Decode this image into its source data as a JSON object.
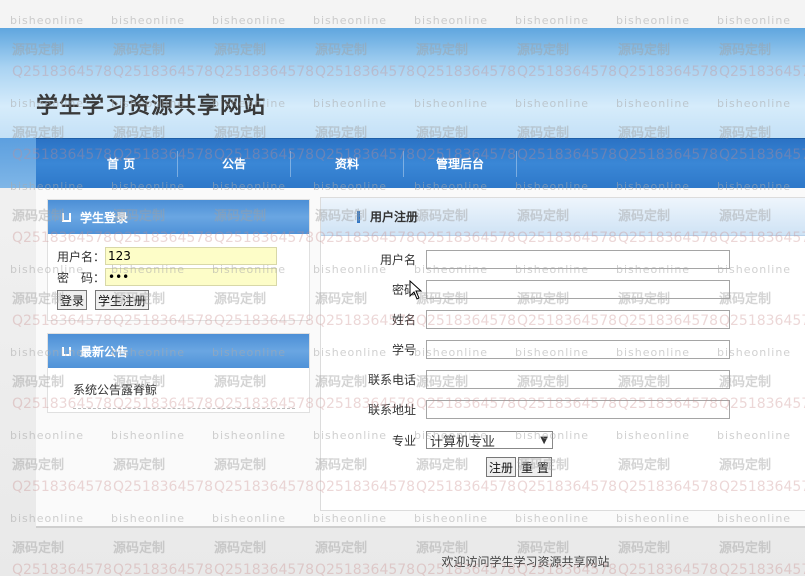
{
  "site": {
    "title": "学生学习资源共享网站"
  },
  "nav": {
    "items": [
      "首 页",
      "公告",
      "资料",
      "管理后台"
    ]
  },
  "login": {
    "title": "学生登录",
    "username_label": "用户名：",
    "username_value": "123",
    "password_label": "密　码：",
    "password_value": "123",
    "login_button": "登录",
    "register_button": "学生注册"
  },
  "notice": {
    "title": "最新公告",
    "items": [
      "系统公告露脊鲸"
    ]
  },
  "register_form": {
    "title": "用户注册",
    "fields": [
      {
        "label": "用户名",
        "value": ""
      },
      {
        "label": "密码",
        "value": ""
      },
      {
        "label": "姓名",
        "value": ""
      },
      {
        "label": "学号",
        "value": ""
      },
      {
        "label": "联系电话",
        "value": ""
      },
      {
        "label": "联系地址",
        "value": ""
      }
    ],
    "major_label": "专业",
    "major_selected": "计算机专业",
    "submit_button": "注册",
    "reset_button": "重 置"
  },
  "footer": {
    "text": "欢迎访问学生学习资源共享网站"
  },
  "watermark": {
    "line_a": "bisheonline",
    "line_b": "源码定制",
    "line_c": "Q2518364578"
  },
  "colors": {
    "nav_blue": "#2e78c9",
    "panel_head_blue": "#5a9bdc",
    "input_highlight": "#fdfdc8"
  }
}
